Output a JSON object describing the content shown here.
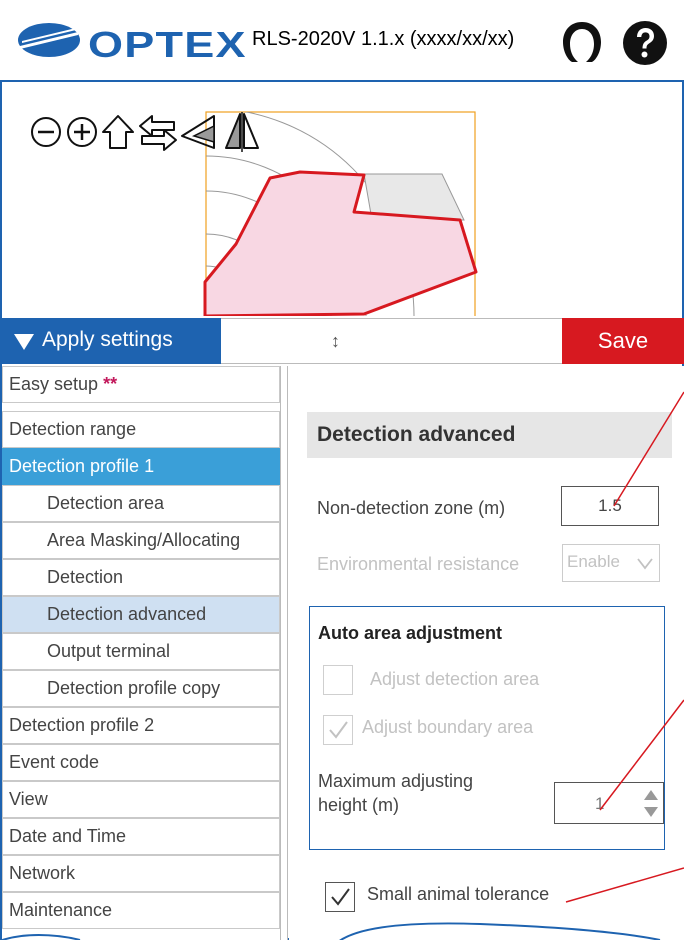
{
  "header": {
    "logo_text": "OPTEX",
    "app_title": "RLS-2020V 1.1.x (xxxx/xx/xx)",
    "icons": [
      "user-icon",
      "help-icon"
    ]
  },
  "toolbar": {
    "tools": [
      "zoom-out-icon",
      "zoom-in-icon",
      "home-icon",
      "swap-arrows-icon",
      "rotate-left-icon",
      "flip-icon"
    ]
  },
  "action_bar": {
    "apply_label": "Apply settings",
    "resize_glyph": "↕",
    "save_label": "Save"
  },
  "sidebar": {
    "items": [
      {
        "label": "Easy setup",
        "badge": "**"
      },
      {
        "label": "Detection range"
      },
      {
        "label": "Detection profile 1"
      },
      {
        "label": "Detection area"
      },
      {
        "label": "Area Masking/Allocating"
      },
      {
        "label": "Detection"
      },
      {
        "label": "Detection advanced"
      },
      {
        "label": "Output terminal"
      },
      {
        "label": "Detection profile copy"
      },
      {
        "label": "Detection profile 2"
      },
      {
        "label": "Event code"
      },
      {
        "label": "View"
      },
      {
        "label": "Date and Time"
      },
      {
        "label": "Network"
      },
      {
        "label": "Maintenance"
      }
    ]
  },
  "content": {
    "section_title": "Detection advanced",
    "non_detection_zone": {
      "label": "Non-detection zone (m)",
      "value": "1.5"
    },
    "environmental_resistance": {
      "label": "Environmental resistance",
      "value": "Enable"
    },
    "auto_area": {
      "title": "Auto area adjustment",
      "adjust_detection_area": {
        "label": "Adjust detection area",
        "checked": false
      },
      "adjust_boundary_area": {
        "label": "Adjust boundary area",
        "checked": true
      },
      "max_height": {
        "label_line1": "Maximum adjusting",
        "label_line2": "height (m)",
        "value": "1"
      }
    },
    "small_animal": {
      "label": "Small animal tolerance",
      "checked": true
    }
  },
  "colors": {
    "brand_blue": "#1e63b0",
    "save_red": "#d71920",
    "active_item": "#3a9fd8",
    "selected_item": "#cfe0f2",
    "zone_fill": "#f8d7e3",
    "zone_stroke": "#d71920",
    "map_border": "#f0a020"
  }
}
